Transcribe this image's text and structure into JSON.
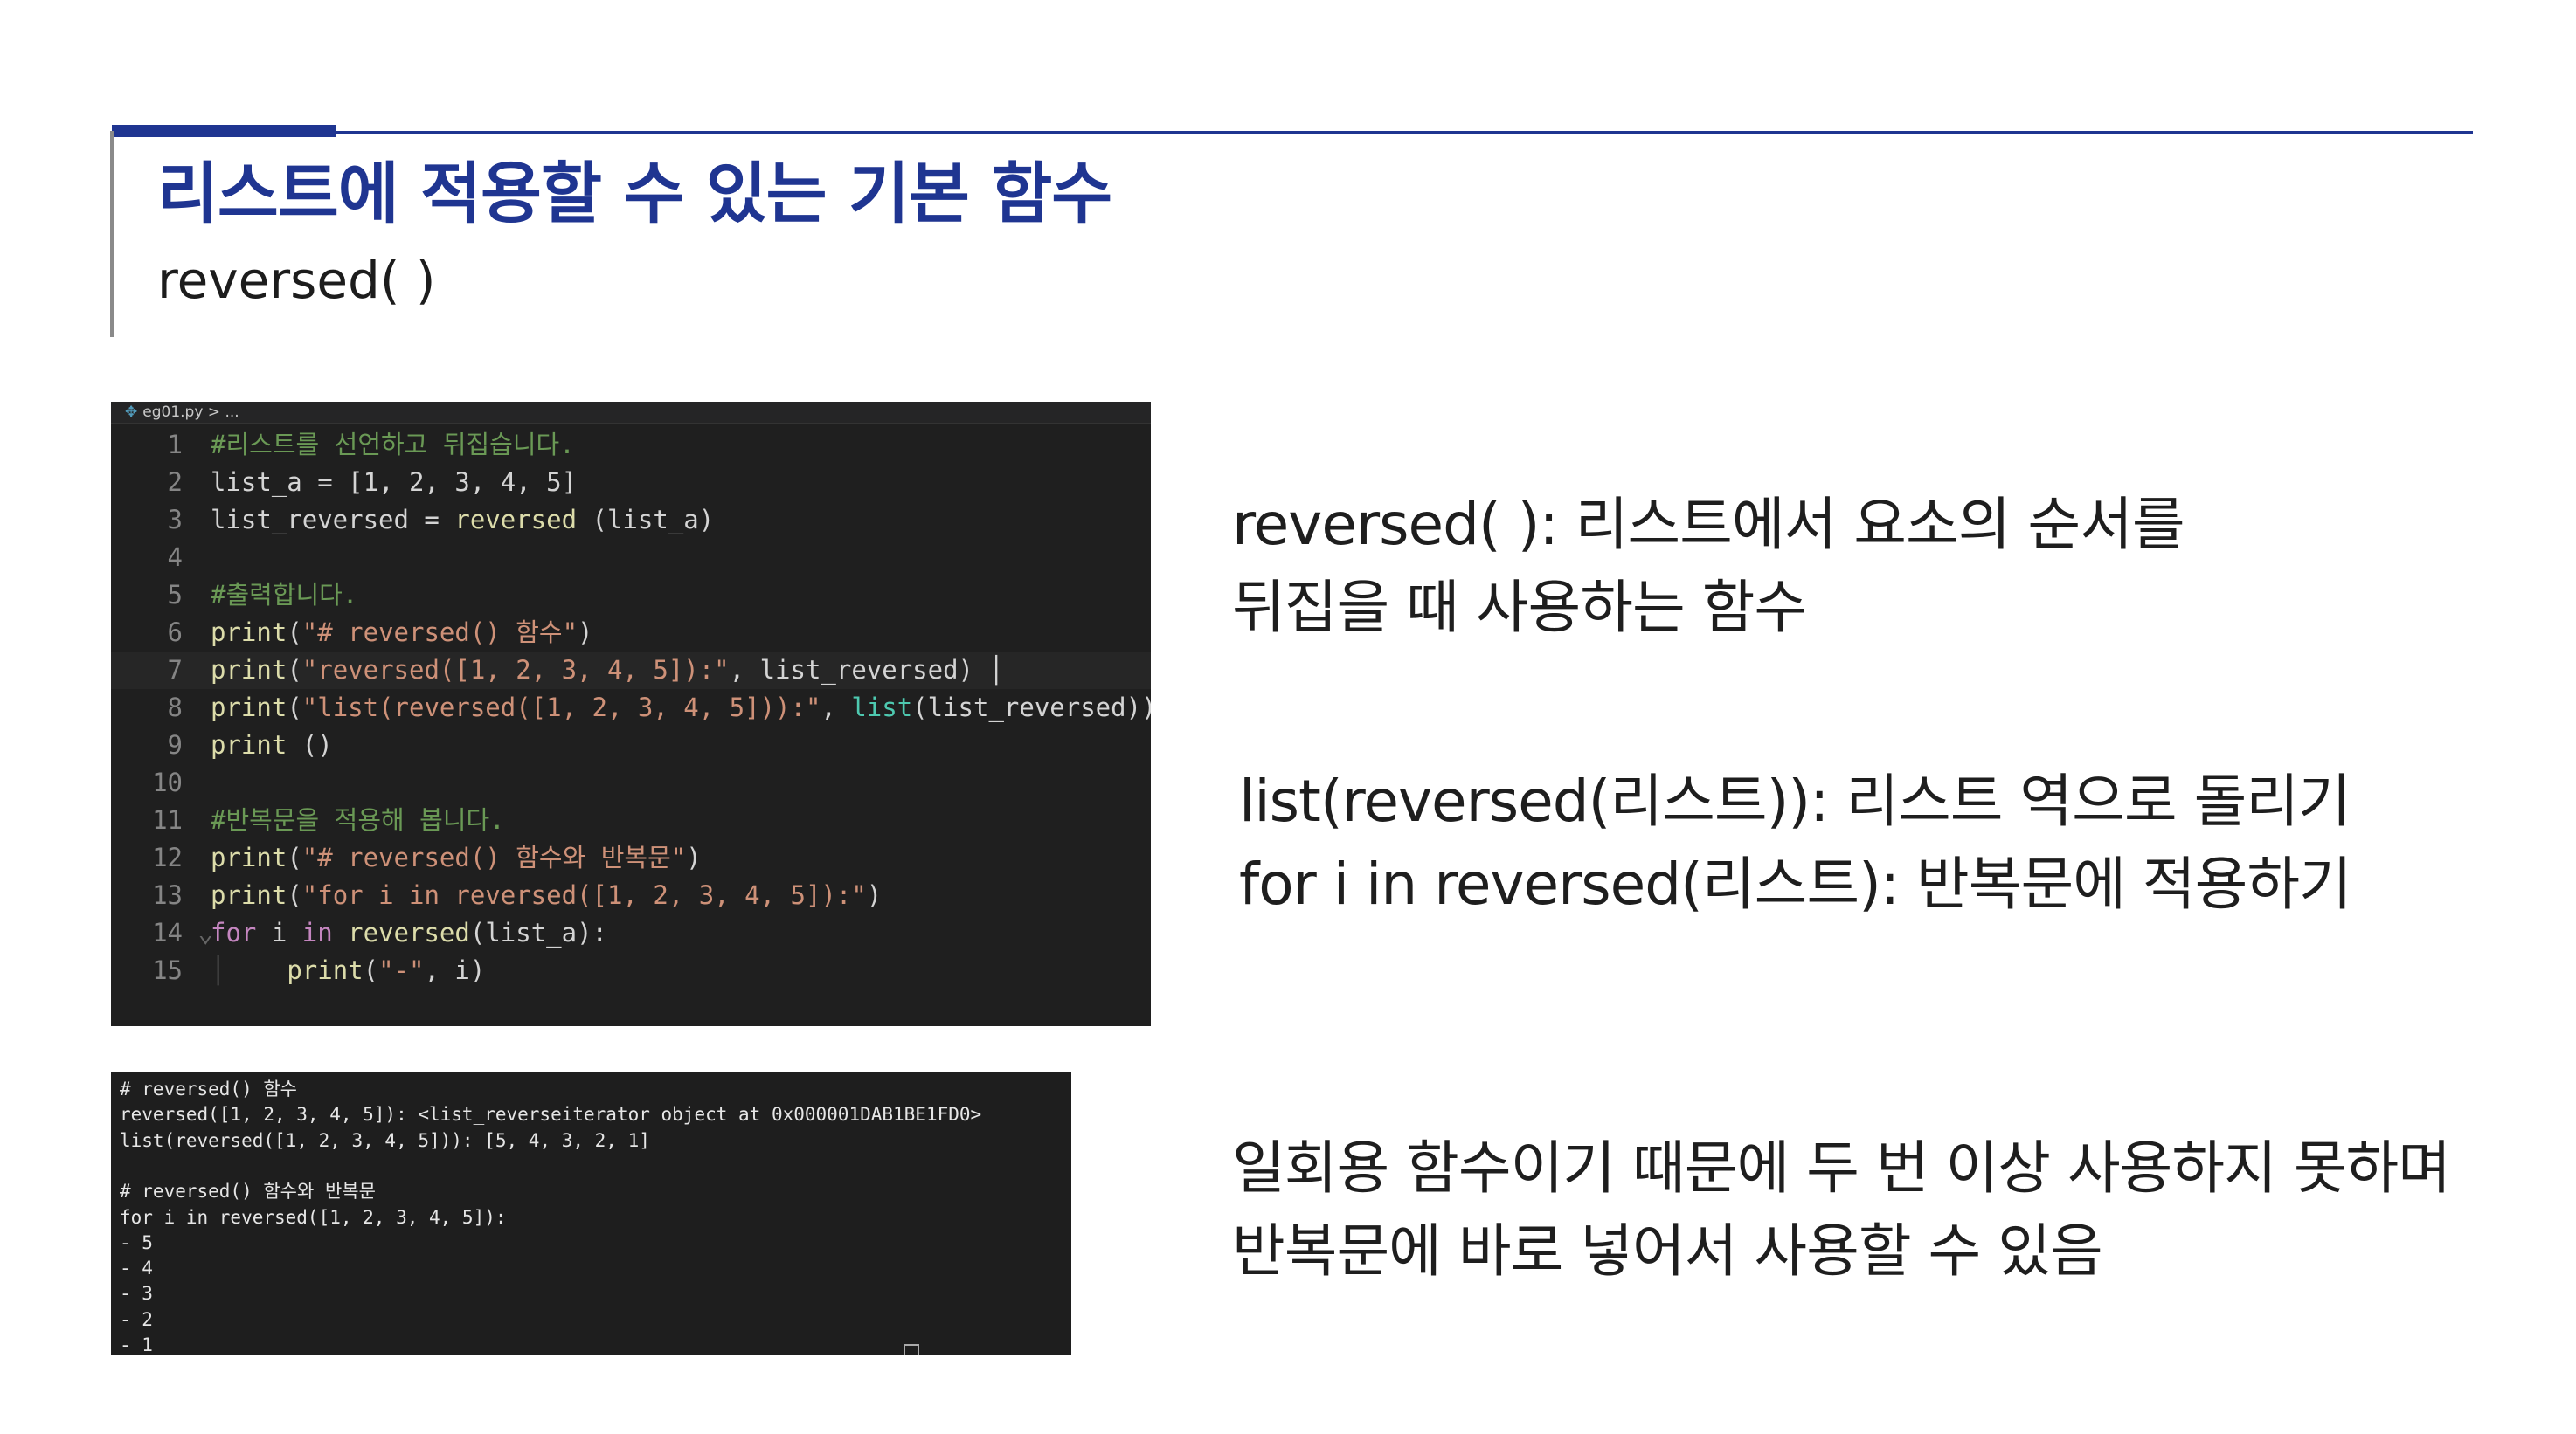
{
  "colors": {
    "accent": "#1f3591",
    "editor_bg": "#1f1f1f",
    "terminal_bg": "#1e1e1e"
  },
  "header": {
    "title": "리스트에 적용할 수 있는 기본 함수",
    "subtitle": "reversed( )"
  },
  "editor": {
    "file_icon": "python-file-icon",
    "breadcrumb": "eg01.py > ...",
    "lines": [
      {
        "num": "1",
        "tokens": [
          {
            "t": "#리스트를 선언하고 뒤집습니다.",
            "k": "c"
          }
        ]
      },
      {
        "num": "2",
        "tokens": [
          {
            "t": "list_a = [1, 2, 3, 4, 5]",
            "k": "p"
          }
        ]
      },
      {
        "num": "3",
        "tokens": [
          {
            "t": "list_reversed = ",
            "k": "p"
          },
          {
            "t": "reversed",
            "k": "f"
          },
          {
            "t": " (list_a)",
            "k": "p"
          }
        ]
      },
      {
        "num": "4",
        "tokens": []
      },
      {
        "num": "5",
        "tokens": [
          {
            "t": "#출력합니다.",
            "k": "c"
          }
        ]
      },
      {
        "num": "6",
        "tokens": [
          {
            "t": "print",
            "k": "f"
          },
          {
            "t": "(",
            "k": "p"
          },
          {
            "t": "\"# reversed() 함수\"",
            "k": "s"
          },
          {
            "t": ")",
            "k": "p"
          }
        ]
      },
      {
        "num": "7",
        "active": true,
        "tokens": [
          {
            "t": "print",
            "k": "f"
          },
          {
            "t": "(",
            "k": "p"
          },
          {
            "t": "\"reversed([1, 2, 3, 4, 5]):\"",
            "k": "s"
          },
          {
            "t": ", list_reversed) │",
            "k": "p"
          }
        ]
      },
      {
        "num": "8",
        "tokens": [
          {
            "t": "print",
            "k": "f"
          },
          {
            "t": "(",
            "k": "p"
          },
          {
            "t": "\"list(reversed([1, 2, 3, 4, 5])):\"",
            "k": "s"
          },
          {
            "t": ", ",
            "k": "p"
          },
          {
            "t": "list",
            "k": "b"
          },
          {
            "t": "(list_reversed))",
            "k": "p"
          }
        ]
      },
      {
        "num": "9",
        "tokens": [
          {
            "t": "print",
            "k": "f"
          },
          {
            "t": " ()",
            "k": "p"
          }
        ]
      },
      {
        "num": "10",
        "tokens": []
      },
      {
        "num": "11",
        "tokens": [
          {
            "t": "#반복문을 적용해 봅니다.",
            "k": "c"
          }
        ]
      },
      {
        "num": "12",
        "tokens": [
          {
            "t": "print",
            "k": "f"
          },
          {
            "t": "(",
            "k": "p"
          },
          {
            "t": "\"# reversed() 함수와 반복문\"",
            "k": "s"
          },
          {
            "t": ")",
            "k": "p"
          }
        ]
      },
      {
        "num": "13",
        "tokens": [
          {
            "t": "print",
            "k": "f"
          },
          {
            "t": "(",
            "k": "p"
          },
          {
            "t": "\"for i in reversed([1, 2, 3, 4, 5]):\"",
            "k": "s"
          },
          {
            "t": ")",
            "k": "p"
          }
        ]
      },
      {
        "num": "14",
        "fold": "⌄",
        "tokens": [
          {
            "t": "for",
            "k": "k"
          },
          {
            "t": " i ",
            "k": "p"
          },
          {
            "t": "in",
            "k": "k"
          },
          {
            "t": " ",
            "k": "p"
          },
          {
            "t": "reversed",
            "k": "f"
          },
          {
            "t": "(list_a):",
            "k": "p"
          }
        ]
      },
      {
        "num": "15",
        "guide": "│",
        "tokens": [
          {
            "t": "    ",
            "k": "p"
          },
          {
            "t": "print",
            "k": "f"
          },
          {
            "t": "(",
            "k": "p"
          },
          {
            "t": "\"-\"",
            "k": "s"
          },
          {
            "t": ", i)",
            "k": "p"
          }
        ]
      }
    ]
  },
  "terminal": {
    "lines": [
      "# reversed() 함수",
      "reversed([1, 2, 3, 4, 5]): <list_reverseiterator object at 0x000001DAB1BE1FD0>",
      "list(reversed([1, 2, 3, 4, 5])): [5, 4, 3, 2, 1]",
      "",
      "# reversed() 함수와 반복문",
      "for i in reversed([1, 2, 3, 4, 5]):",
      "- 5",
      "- 4",
      "- 3",
      "- 2",
      "- 1"
    ]
  },
  "descriptions": {
    "reversed_1": "reversed( ): 리스트에서 요소의 순서를",
    "reversed_2": "뒤집을 때 사용하는 함수",
    "list_reversed": "list(reversed(리스트)): 리스트 역으로 돌리기",
    "for_loop": "for i in reversed(리스트): 반복문에 적용하기",
    "note_1": "일회용 함수이기 때문에 두 번 이상 사용하지 못하며",
    "note_2": "반복문에 바로 넣어서 사용할 수 있음"
  }
}
